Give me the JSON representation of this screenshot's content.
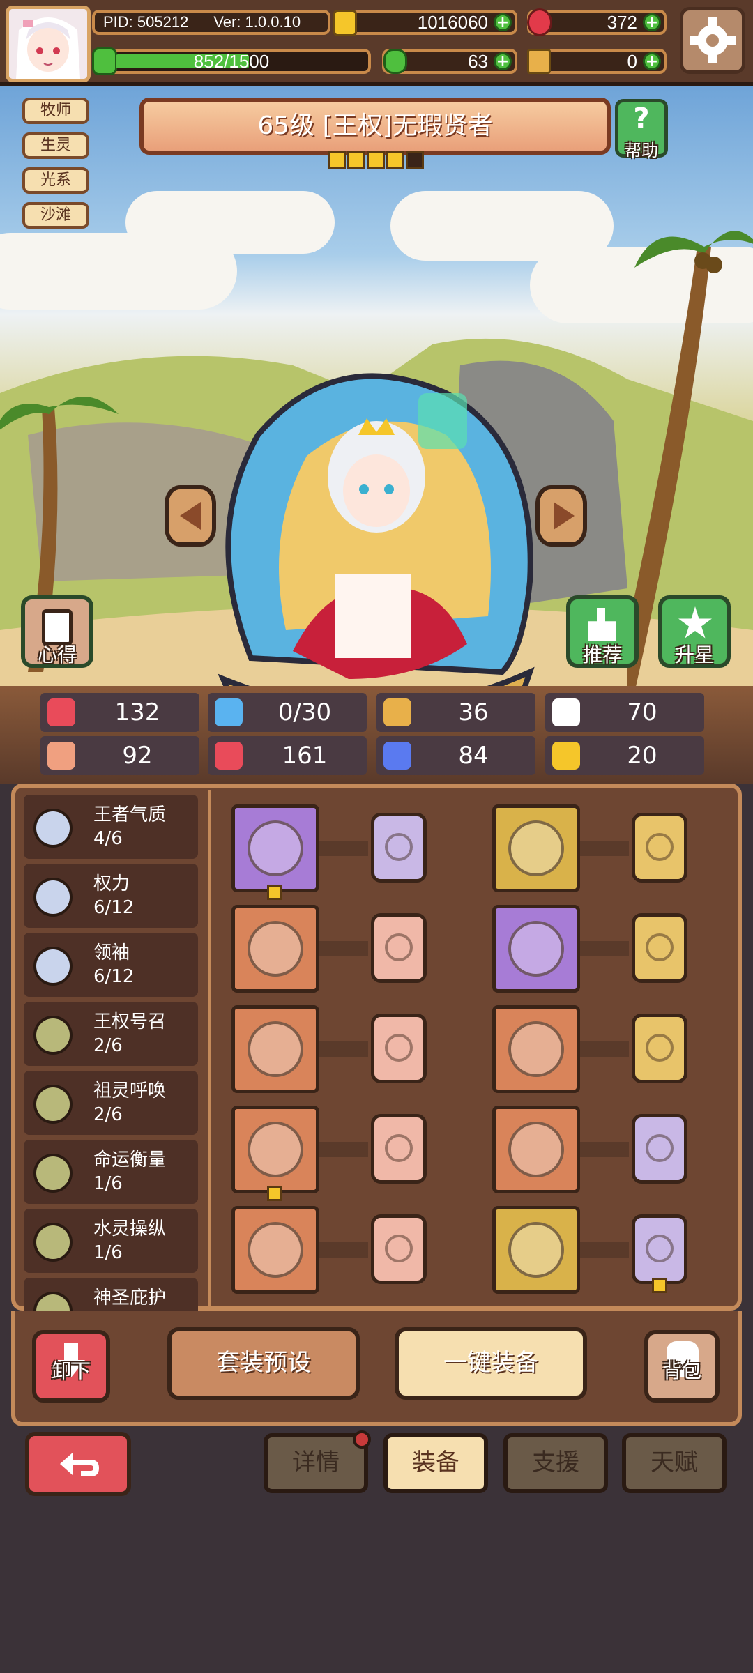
{
  "header": {
    "pid": "PID: 505212",
    "version": "Ver: 1.0.0.10",
    "gold": "1016060",
    "gems": "372",
    "exp": "852/1500",
    "clover": "63",
    "keys": "0",
    "exp_progress": 0.568
  },
  "tags": [
    "牧师",
    "生灵",
    "光系",
    "沙滩"
  ],
  "hero": {
    "title": "65级  [王权]无瑕贤者",
    "stars": 4,
    "max_stars": 5,
    "help_label": "帮助",
    "notes_label": "心得",
    "recommend_label": "推荐",
    "upstar_label": "升星"
  },
  "stats": [
    {
      "icon": "heart-icon",
      "value": "132",
      "color": "#e94b5a"
    },
    {
      "icon": "water-drop-icon",
      "value": "0/30",
      "color": "#5ab3f0"
    },
    {
      "icon": "shield-icon",
      "value": "36",
      "color": "#e8b04a"
    },
    {
      "icon": "feather-icon",
      "value": "70",
      "color": "#ffffff"
    },
    {
      "icon": "fist-icon",
      "value": "92",
      "color": "#f0a080"
    },
    {
      "icon": "book-icon",
      "value": "161",
      "color": "#e94b5a"
    },
    {
      "icon": "boot-icon",
      "value": "84",
      "color": "#5a7af0"
    },
    {
      "icon": "horseshoe-icon",
      "value": "20",
      "color": "#f5c62a"
    }
  ],
  "sets": [
    {
      "name": "王者气质",
      "count": "4/6",
      "color": "#c9d4ec"
    },
    {
      "name": "权力",
      "count": "6/12",
      "color": "#c9d4ec"
    },
    {
      "name": "领袖",
      "count": "6/12",
      "color": "#c9d4ec"
    },
    {
      "name": "王权号召",
      "count": "2/6",
      "color": "#b8b87a"
    },
    {
      "name": "祖灵呼唤",
      "count": "2/6",
      "color": "#b8b87a"
    },
    {
      "name": "命运衡量",
      "count": "1/6",
      "color": "#b8b87a"
    },
    {
      "name": "水灵操纵",
      "count": "1/6",
      "color": "#b8b87a"
    },
    {
      "name": "神圣庇护",
      "count": "",
      "color": "#b8b87a"
    }
  ],
  "equipment_left": [
    {
      "item": "scepter-icon",
      "frame": "#a77cd6",
      "rune": "#c9b8e6",
      "item_star": true,
      "rune_star": false
    },
    {
      "item": "orb-icon",
      "frame": "#d9845a",
      "rune": "#f0b8a8",
      "item_star": false,
      "rune_star": false
    },
    {
      "item": "necklace-icon",
      "frame": "#d9845a",
      "rune": "#f0b8a8",
      "item_star": false,
      "rune_star": false
    },
    {
      "item": "amulet-icon",
      "frame": "#d9845a",
      "rune": "#f0b8a8",
      "item_star": true,
      "rune_star": false
    },
    {
      "item": "ring-icon",
      "frame": "#d9845a",
      "rune": "#f0b8a8",
      "item_star": false,
      "rune_star": false
    }
  ],
  "equipment_right": [
    {
      "item": "crown-icon",
      "frame": "#d9b24a",
      "rune": "#e8c46a",
      "item_star": false,
      "rune_star": false
    },
    {
      "item": "robe-icon",
      "frame": "#a77cd6",
      "rune": "#e8c46a",
      "item_star": false,
      "rune_star": false
    },
    {
      "item": "glove-icon",
      "frame": "#d9845a",
      "rune": "#e8c46a",
      "item_star": false,
      "rune_star": false
    },
    {
      "item": "belt-icon",
      "frame": "#d9845a",
      "rune": "#c9b8e6",
      "item_star": false,
      "rune_star": false
    },
    {
      "item": "boots-icon",
      "frame": "#d9b24a",
      "rune": "#c9b8e6",
      "item_star": false,
      "rune_star": true
    }
  ],
  "actions": {
    "unequip_label": "卸下",
    "preset_label": "套装预设",
    "auto_equip_label": "一键装备",
    "bag_label": "背包"
  },
  "tabs": [
    "详情",
    "装备",
    "支援",
    "天赋"
  ],
  "active_tab": 1
}
